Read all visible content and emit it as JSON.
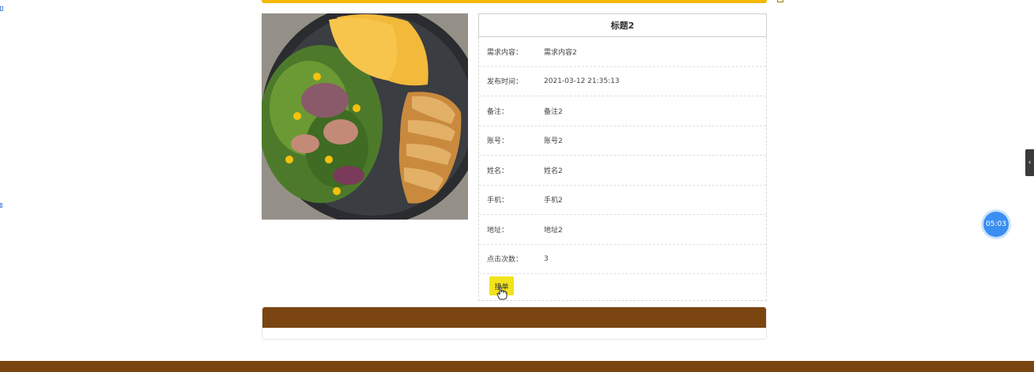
{
  "detail": {
    "title": "标题2",
    "rows": [
      {
        "label": "需求内容：",
        "value": "需求内容2"
      },
      {
        "label": "发布时间：",
        "value": "2021-03-12 21:35:13"
      },
      {
        "label": "备注：",
        "value": "备注2"
      },
      {
        "label": "账号：",
        "value": "账号2"
      },
      {
        "label": "姓名：",
        "value": "姓名2"
      },
      {
        "label": "手机：",
        "value": "手机2"
      },
      {
        "label": "地址：",
        "value": "地址2"
      },
      {
        "label": "点击次数：",
        "value": "3"
      }
    ],
    "order_button": "接单"
  },
  "timer": {
    "text": "05:03"
  },
  "side_handle": {
    "icon": "chevron-left-icon",
    "glyph": "‹"
  },
  "colors": {
    "top_accent": "#f5b800",
    "brown": "#7a4510",
    "button_yellow": "#f2e31c",
    "timer_blue": "#3b8ff2"
  }
}
